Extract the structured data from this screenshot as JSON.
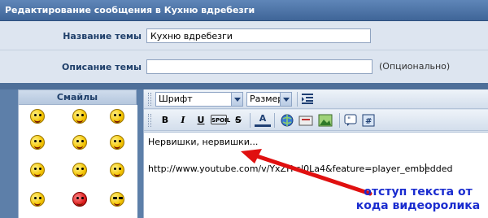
{
  "header": {
    "title": "Редактирование сообщения в Кухню вдребезги"
  },
  "form": {
    "topic_name_label": "Название темы",
    "topic_name_value": "Кухню вдребезги",
    "topic_desc_label": "Описание темы",
    "topic_desc_value": "",
    "topic_desc_hint": "(Опционально)"
  },
  "smiles": {
    "title": "Смайлы"
  },
  "toolbar": {
    "font_select": "Шрифт",
    "size_select": "Размер",
    "bold": "B",
    "italic": "I",
    "underline": "U",
    "spoiler": "SPOIL",
    "strike": "S",
    "color": "A"
  },
  "editor": {
    "line1": "Нервишки, нервишки...",
    "line2": "http://www.youtube.com/v/YxZH-sl0La4&feature=player_embedded"
  },
  "annotation": {
    "text": "отступ текста от кода видеоролика",
    "color": "#1a2ccf",
    "arrow_color": "#e01010"
  }
}
